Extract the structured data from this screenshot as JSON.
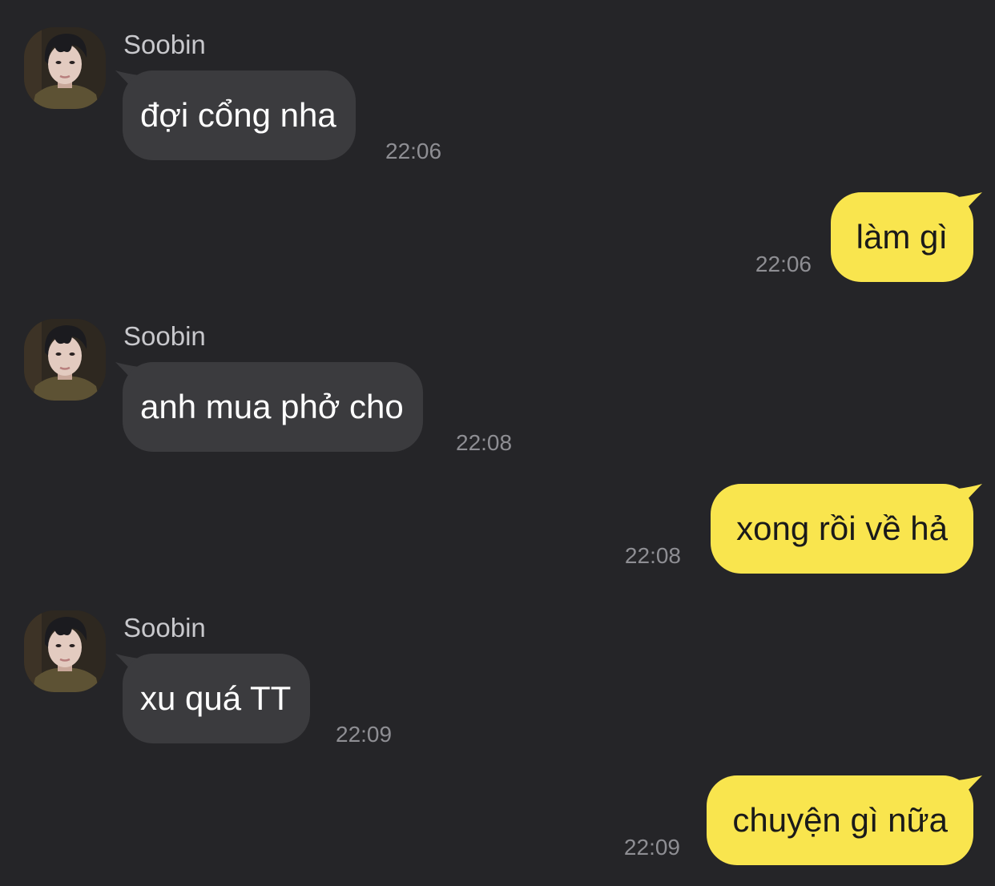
{
  "conversation": {
    "colors": {
      "background": "#252528",
      "incoming_bubble": "#3b3b3e",
      "outgoing_bubble": "#f9e54e",
      "timestamp": "#8e8e93",
      "sender_name": "#c8c8cc"
    },
    "messages": [
      {
        "direction": "incoming",
        "sender": "Soobin",
        "text": "đợi cổng nha",
        "time": "22:06",
        "avatar_icon": "profile-photo"
      },
      {
        "direction": "outgoing",
        "text": "làm gì",
        "time": "22:06"
      },
      {
        "direction": "incoming",
        "sender": "Soobin",
        "text": "anh mua phở cho",
        "time": "22:08",
        "avatar_icon": "profile-photo"
      },
      {
        "direction": "outgoing",
        "text": "xong rồi về hả",
        "time": "22:08"
      },
      {
        "direction": "incoming",
        "sender": "Soobin",
        "text": "xu quá TT",
        "time": "22:09",
        "avatar_icon": "profile-photo"
      },
      {
        "direction": "outgoing",
        "text": "chuyện gì nữa",
        "time": "22:09"
      }
    ]
  }
}
